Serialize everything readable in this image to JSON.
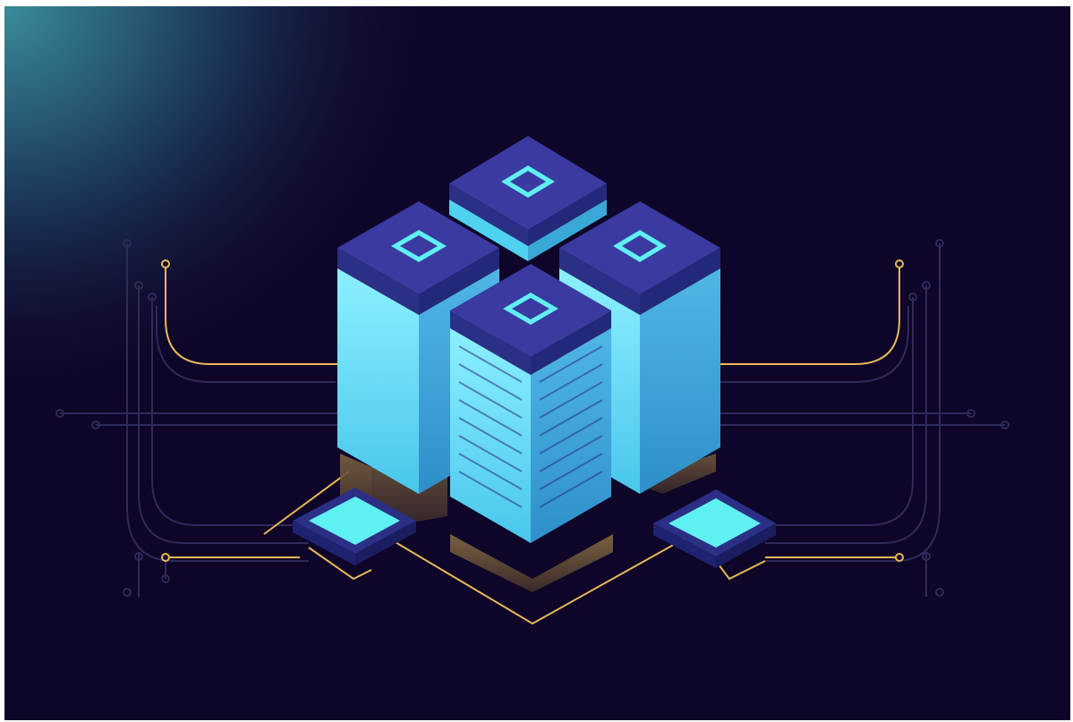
{
  "scene": {
    "subject": "isometric-server-racks",
    "rack_count": 4,
    "chip_count": 2,
    "colors": {
      "background": "#0e0528",
      "glow": "#3a8c98",
      "circuit_line": "#2e2a5a",
      "circuit_accent": "#e8b85a",
      "rack_light": "#7fe6ff",
      "rack_side": "#3aa8d6",
      "rack_dark": "#2b2f86",
      "rack_top": "#3a3aa0",
      "chip_screen": "#5ff0f2",
      "floor_glow": "#6a5336"
    }
  }
}
